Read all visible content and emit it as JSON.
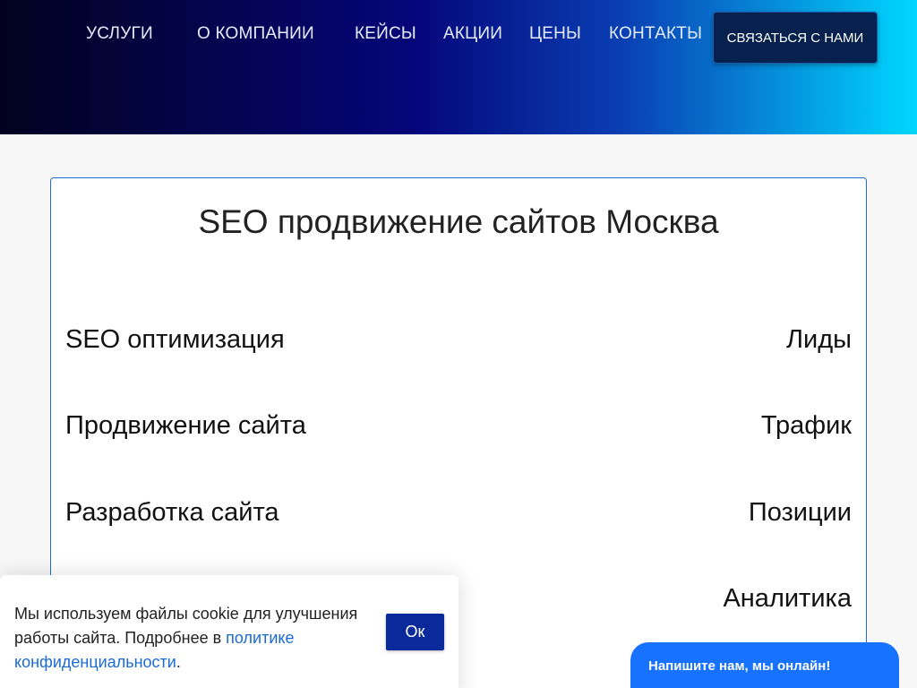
{
  "header": {
    "nav": [
      "УСЛУГИ",
      "О КОМПАНИИ",
      "КЕЙСЫ",
      "АКЦИИ",
      "ЦЕНЫ",
      "КОНТАКТЫ"
    ],
    "cta_label": "СВЯЗАТЬСЯ С НАМИ"
  },
  "main": {
    "title": "SEO продвижение сайтов Москва",
    "services_left": [
      "SEO оптимизация",
      "Продвижение сайта",
      "Разработка сайта"
    ],
    "services_right": [
      "Лиды",
      "Трафик",
      "Позиции",
      "Аналитика"
    ]
  },
  "cookie": {
    "text_before": "Мы используем файлы cookie для улучшения работы сайта. Подробнее в ",
    "link_text": "политике конфиденциальности",
    "text_after": ".",
    "ok_label": "Ок"
  },
  "chat": {
    "label": "Напишите нам, мы онлайн!"
  },
  "colors": {
    "accent": "#1672ff",
    "card_border": "#1e6fd0",
    "cookie_button": "#0a2a9c",
    "link": "#1a6bd6"
  }
}
